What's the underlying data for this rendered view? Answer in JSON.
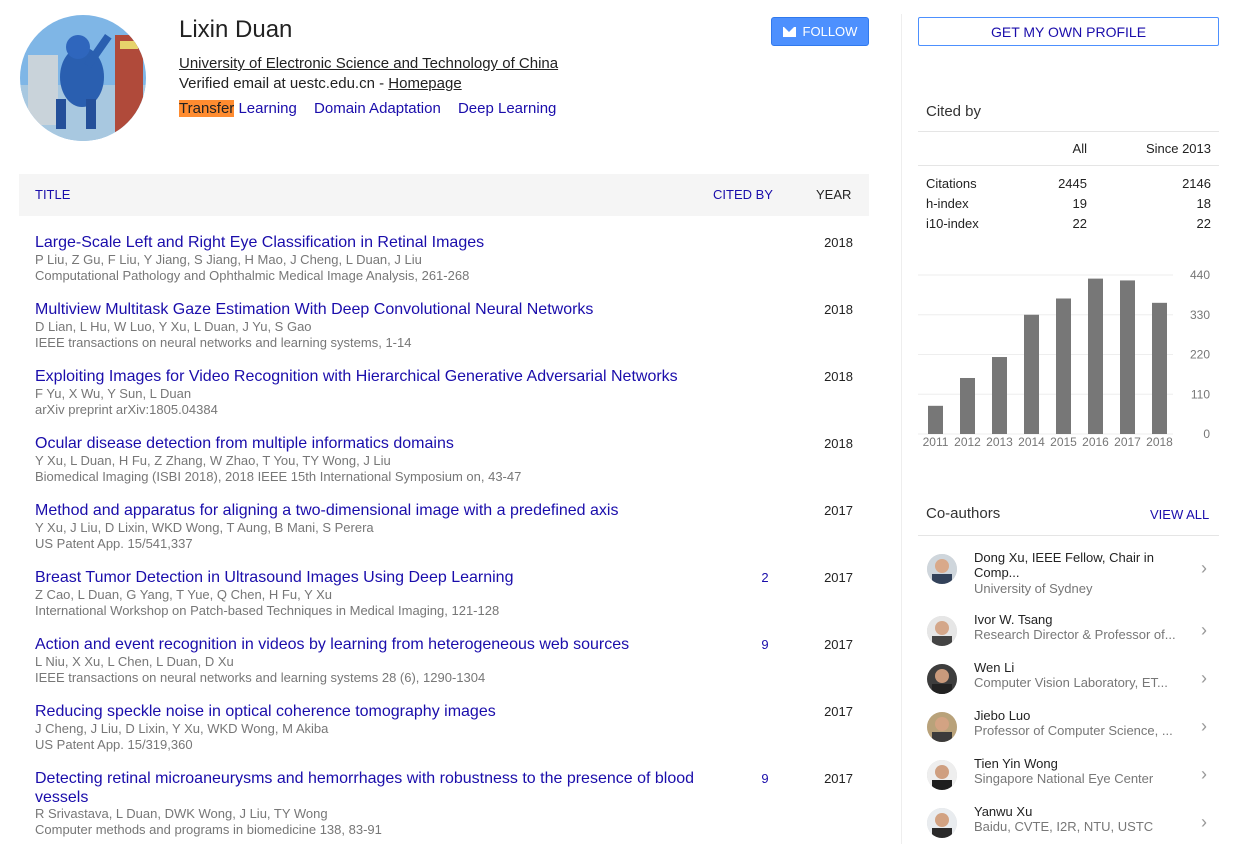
{
  "profile": {
    "name": "Lixin Duan",
    "affiliation": "University of Electronic Science and Technology of China",
    "email_prefix": "Verified email at uestc.edu.cn - ",
    "homepage": "Homepage",
    "interests": [
      {
        "highlight": "Transfer",
        "rest": " Learning"
      },
      {
        "highlight": "",
        "rest": "Domain Adaptation"
      },
      {
        "highlight": "",
        "rest": "Deep Learning"
      }
    ],
    "follow_label": "FOLLOW",
    "follow_icon": "envelope-icon"
  },
  "table": {
    "headers": {
      "title": "TITLE",
      "cited_by": "CITED BY",
      "year": "YEAR"
    },
    "rows": [
      {
        "title": "Large-Scale Left and Right Eye Classification in Retinal Images",
        "authors": "P Liu, Z Gu, F Liu, Y Jiang, S Jiang, H Mao, J Cheng, L Duan, J Liu",
        "venue": "Computational Pathology and Ophthalmic Medical Image Analysis, 261-268",
        "cited": "",
        "year": "2018"
      },
      {
        "title": "Multiview Multitask Gaze Estimation With Deep Convolutional Neural Networks",
        "authors": "D Lian, L Hu, W Luo, Y Xu, L Duan, J Yu, S Gao",
        "venue": "IEEE transactions on neural networks and learning systems, 1-14",
        "cited": "",
        "year": "2018"
      },
      {
        "title": "Exploiting Images for Video Recognition with Hierarchical Generative Adversarial Networks",
        "authors": "F Yu, X Wu, Y Sun, L Duan",
        "venue": "arXiv preprint arXiv:1805.04384",
        "cited": "",
        "year": "2018"
      },
      {
        "title": "Ocular disease detection from multiple informatics domains",
        "authors": "Y Xu, L Duan, H Fu, Z Zhang, W Zhao, T You, TY Wong, J Liu",
        "venue": "Biomedical Imaging (ISBI 2018), 2018 IEEE 15th International Symposium on, 43-47",
        "cited": "",
        "year": "2018"
      },
      {
        "title": "Method and apparatus for aligning a two-dimensional image with a predefined axis",
        "authors": "Y Xu, J Liu, D Lixin, WKD Wong, T Aung, B Mani, S Perera",
        "venue": "US Patent App. 15/541,337",
        "cited": "",
        "year": "2017"
      },
      {
        "title": "Breast Tumor Detection in Ultrasound Images Using Deep Learning",
        "authors": "Z Cao, L Duan, G Yang, T Yue, Q Chen, H Fu, Y Xu",
        "venue": "International Workshop on Patch-based Techniques in Medical Imaging, 121-128",
        "cited": "2",
        "year": "2017"
      },
      {
        "title": "Action and event recognition in videos by learning from heterogeneous web sources",
        "authors": "L Niu, X Xu, L Chen, L Duan, D Xu",
        "venue": "IEEE transactions on neural networks and learning systems 28 (6), 1290-1304",
        "cited": "9",
        "year": "2017"
      },
      {
        "title": "Reducing speckle noise in optical coherence tomography images",
        "authors": "J Cheng, J Liu, D Lixin, Y Xu, WKD Wong, M Akiba",
        "venue": "US Patent App. 15/319,360",
        "cited": "",
        "year": "2017"
      },
      {
        "title": "Detecting retinal microaneurysms and hemorrhages with robustness to the presence of blood vessels",
        "authors": "R Srivastava, L Duan, DWK Wong, J Liu, TY Wong",
        "venue": "Computer methods and programs in biomedicine 138, 83-91",
        "cited": "9",
        "year": "2017"
      }
    ]
  },
  "sidebar": {
    "get_profile": "GET MY OWN PROFILE",
    "cited_by": {
      "title": "Cited by",
      "col_all": "All",
      "col_since": "Since 2013",
      "rows": [
        {
          "label": "Citations",
          "all": "2445",
          "since": "2146"
        },
        {
          "label": "h-index",
          "all": "19",
          "since": "18"
        },
        {
          "label": "i10-index",
          "all": "22",
          "since": "22"
        }
      ]
    },
    "coauthors": {
      "title": "Co-authors",
      "view_all": "VIEW ALL",
      "items": [
        {
          "name": "Dong Xu, IEEE Fellow, Chair in Comp...",
          "aff": "University of Sydney"
        },
        {
          "name": "Ivor W. Tsang",
          "aff": "Research Director & Professor of..."
        },
        {
          "name": "Wen Li",
          "aff": "Computer Vision Laboratory, ET..."
        },
        {
          "name": "Jiebo Luo",
          "aff": "Professor of Computer Science, ..."
        },
        {
          "name": "Tien Yin Wong",
          "aff": "Singapore National Eye Center"
        },
        {
          "name": "Yanwu Xu",
          "aff": "Baidu, CVTE, I2R, NTU, USTC"
        }
      ],
      "chevron_icon": "chevron-right-icon"
    }
  },
  "chart_data": {
    "type": "bar",
    "categories": [
      "2011",
      "2012",
      "2013",
      "2014",
      "2015",
      "2016",
      "2017",
      "2018"
    ],
    "values": [
      78,
      155,
      213,
      330,
      375,
      430,
      425,
      363
    ],
    "ylim": [
      0,
      440
    ],
    "yticks": [
      "440",
      "330",
      "220",
      "110",
      "0"
    ],
    "bar_color": "#777777",
    "grid": true
  },
  "colors": {
    "link": "#1a0dab",
    "follow_bg": "#4d90fe",
    "highlight": "#ff8c30"
  }
}
